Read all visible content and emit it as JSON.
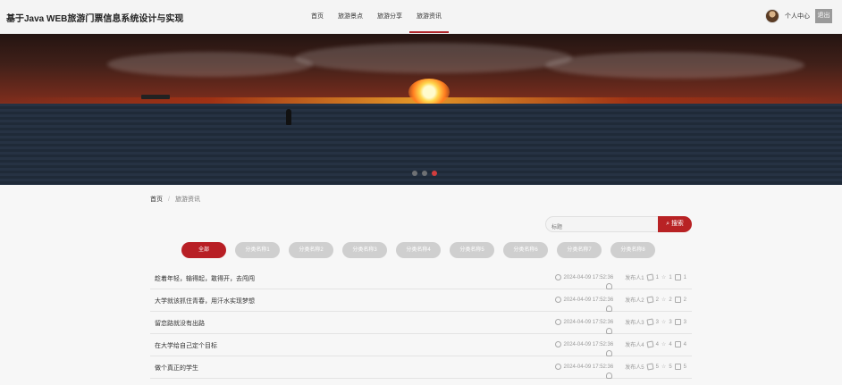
{
  "site": {
    "title": "基于Java WEB旅游门票信息系统设计与实现"
  },
  "nav": [
    {
      "label": "首页",
      "active": false
    },
    {
      "label": "旅游景点",
      "active": false
    },
    {
      "label": "旅游分享",
      "active": false
    },
    {
      "label": "旅游资讯",
      "active": true
    }
  ],
  "user": {
    "center_label": "个人中心",
    "logout_label": "退出"
  },
  "banner": {
    "slide_count": 3,
    "active_slide": 3
  },
  "breadcrumb": {
    "home": "首页",
    "separator": "/",
    "current": "旅游资讯"
  },
  "search": {
    "placeholder": "标题",
    "button_label": "搜索",
    "value": ""
  },
  "categories": [
    "全部",
    "分类名称1",
    "分类名称2",
    "分类名称3",
    "分类名称4",
    "分类名称5",
    "分类名称6",
    "分类名称7",
    "分类名称8"
  ],
  "active_category": 0,
  "articles": [
    {
      "title": "趁着年轻，输得起，敢得开，去闯闯",
      "date": "2024-04-09 17:52:36",
      "author": "发布人1",
      "likes": "1",
      "favorites": "1",
      "comments": "1"
    },
    {
      "title": "大学就该抓住青春，用汗水实现梦想",
      "date": "2024-04-09 17:52:36",
      "author": "发布人2",
      "likes": "2",
      "favorites": "2",
      "comments": "2"
    },
    {
      "title": "留恋路就没有出路",
      "date": "2024-04-09 17:52:36",
      "author": "发布人3",
      "likes": "3",
      "favorites": "3",
      "comments": "3"
    },
    {
      "title": "在大学给自己定个目标",
      "date": "2024-04-09 17:52:36",
      "author": "发布人4",
      "likes": "4",
      "favorites": "4",
      "comments": "4"
    },
    {
      "title": "做个真正的学生",
      "date": "2024-04-09 17:52:36",
      "author": "发布人5",
      "likes": "5",
      "favorites": "5",
      "comments": "5"
    }
  ],
  "colors": {
    "accent": "#b81f25",
    "background": "#f7f7f7"
  }
}
